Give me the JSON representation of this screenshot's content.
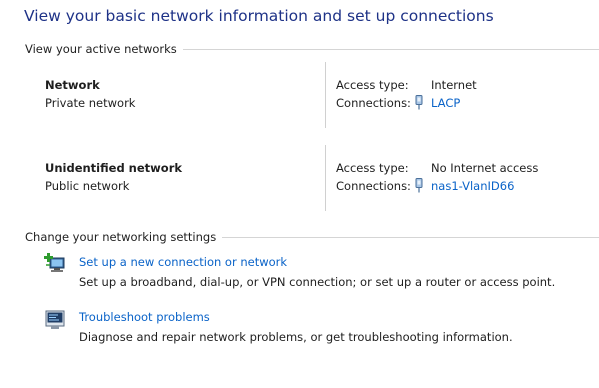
{
  "page": {
    "title": "View your basic network information and set up connections"
  },
  "active_networks": {
    "section_label": "View your active networks",
    "access_type_label": "Access type:",
    "connections_label": "Connections:",
    "networks": [
      {
        "name": "Network",
        "category": "Private network",
        "access_type": "Internet",
        "connection": "LACP",
        "connection_icon": "ethernet-adapter-icon"
      },
      {
        "name": "Unidentified network",
        "category": "Public network",
        "access_type": "No Internet access",
        "connection": "nas1-VlanID66",
        "connection_icon": "ethernet-adapter-icon"
      }
    ]
  },
  "networking_settings": {
    "section_label": "Change your networking settings",
    "tasks": [
      {
        "link": "Set up a new connection or network",
        "description": "Set up a broadband, dial-up, or VPN connection; or set up a router or access point.",
        "icon": "new-connection-icon"
      },
      {
        "link": "Troubleshoot problems",
        "description": "Diagnose and repair network problems, or get troubleshooting information.",
        "icon": "troubleshoot-icon"
      }
    ]
  },
  "colors": {
    "title": "#1e3287",
    "link": "#0a63c8",
    "text": "#1e1e1e",
    "rule": "#d5d5d5"
  }
}
